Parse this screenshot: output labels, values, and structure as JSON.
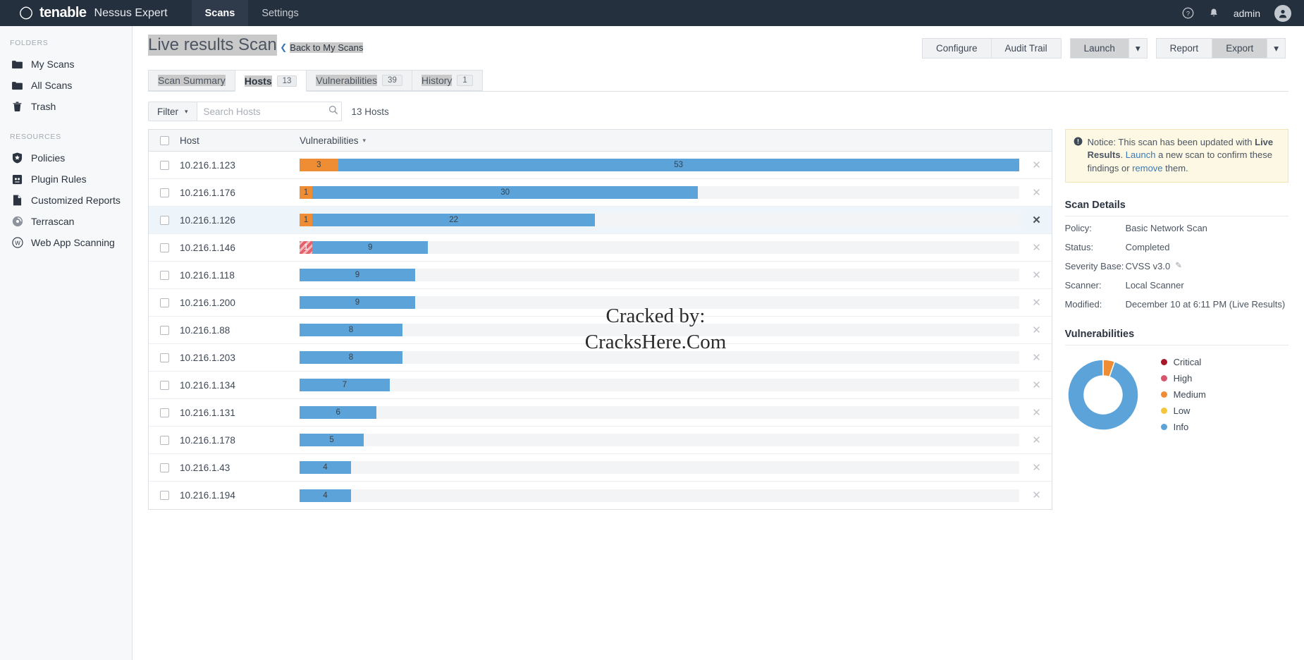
{
  "topnav": {
    "brand": "tenable",
    "product": "Nessus Expert",
    "items": [
      {
        "label": "Scans",
        "active": true
      },
      {
        "label": "Settings",
        "active": false
      }
    ],
    "help_icon": "help-circle-icon",
    "bell_icon": "notification-bell-icon",
    "user_label": "admin",
    "avatar_icon": "user-avatar-icon"
  },
  "sidebar": {
    "folders_label": "FOLDERS",
    "folders": [
      {
        "label": "My Scans",
        "icon": "folder-icon"
      },
      {
        "label": "All Scans",
        "icon": "folder-icon"
      },
      {
        "label": "Trash",
        "icon": "trash-icon"
      }
    ],
    "resources_label": "RESOURCES",
    "resources": [
      {
        "label": "Policies",
        "icon": "shield-star-icon"
      },
      {
        "label": "Plugin Rules",
        "icon": "plugin-rules-icon"
      },
      {
        "label": "Customized Reports",
        "icon": "document-icon"
      },
      {
        "label": "Terrascan",
        "icon": "terrascan-icon"
      },
      {
        "label": "Web App Scanning",
        "icon": "web-app-scanning-icon"
      }
    ]
  },
  "page": {
    "title": "Live results Scan",
    "back_link": "Back to My Scans",
    "back_chevron": "chevron-left-icon",
    "actions": {
      "configure": "Configure",
      "audit_trail": "Audit Trail",
      "launch": "Launch",
      "launch_caret": "chevron-down-icon",
      "report": "Report",
      "export": "Export",
      "export_caret": "chevron-down-icon"
    }
  },
  "tabs": [
    {
      "label": "Scan Summary",
      "badge": null,
      "active": false
    },
    {
      "label": "Hosts",
      "badge": "13",
      "active": true
    },
    {
      "label": "Vulnerabilities",
      "badge": "39",
      "active": false
    },
    {
      "label": "History",
      "badge": "1",
      "active": false
    }
  ],
  "filterbar": {
    "filter_label": "Filter",
    "filter_caret": "chevron-down-icon",
    "search_placeholder": "Search Hosts",
    "search_value": "",
    "search_icon": "search-icon",
    "host_count": "13 Hosts"
  },
  "table": {
    "columns": {
      "host": "Host",
      "vulnerabilities": "Vulnerabilities"
    },
    "sort_caret": "sort-descending-caret-icon",
    "delete_icon": "close-x-icon",
    "max_total": 56,
    "rows": [
      {
        "host": "10.216.1.123",
        "segments": [
          {
            "severity": "medium",
            "count": 3
          },
          {
            "severity": "info",
            "count": 53
          }
        ],
        "hovered": false
      },
      {
        "host": "10.216.1.176",
        "segments": [
          {
            "severity": "medium",
            "count": 1
          },
          {
            "severity": "info",
            "count": 30
          }
        ],
        "hovered": false
      },
      {
        "host": "10.216.1.126",
        "segments": [
          {
            "severity": "medium",
            "count": 1
          },
          {
            "severity": "info",
            "count": 22
          }
        ],
        "hovered": true
      },
      {
        "host": "10.216.1.146",
        "segments": [
          {
            "severity": "striped",
            "count": 1
          },
          {
            "severity": "info",
            "count": 9
          }
        ],
        "hovered": false
      },
      {
        "host": "10.216.1.118",
        "segments": [
          {
            "severity": "info",
            "count": 9
          }
        ],
        "hovered": false
      },
      {
        "host": "10.216.1.200",
        "segments": [
          {
            "severity": "info",
            "count": 9
          }
        ],
        "hovered": false
      },
      {
        "host": "10.216.1.88",
        "segments": [
          {
            "severity": "info",
            "count": 8
          }
        ],
        "hovered": false
      },
      {
        "host": "10.216.1.203",
        "segments": [
          {
            "severity": "info",
            "count": 8
          }
        ],
        "hovered": false
      },
      {
        "host": "10.216.1.134",
        "segments": [
          {
            "severity": "info",
            "count": 7
          }
        ],
        "hovered": false
      },
      {
        "host": "10.216.1.131",
        "segments": [
          {
            "severity": "info",
            "count": 6
          }
        ],
        "hovered": false
      },
      {
        "host": "10.216.1.178",
        "segments": [
          {
            "severity": "info",
            "count": 5
          }
        ],
        "hovered": false
      },
      {
        "host": "10.216.1.43",
        "segments": [
          {
            "severity": "info",
            "count": 4
          }
        ],
        "hovered": false
      },
      {
        "host": "10.216.1.194",
        "segments": [
          {
            "severity": "info",
            "count": 4
          }
        ],
        "hovered": false
      }
    ]
  },
  "notice": {
    "icon": "info-exclamation-icon",
    "text_1": "Notice: This scan has been updated with ",
    "bold_1": "Live Results",
    "text_2": ". ",
    "link_1": "Launch",
    "text_3": " a new scan to confirm these findings or ",
    "link_2": "remove",
    "text_4": " them."
  },
  "scan_details": {
    "heading": "Scan Details",
    "rows": [
      {
        "key": "Policy:",
        "value": "Basic Network Scan",
        "edit": false
      },
      {
        "key": "Status:",
        "value": "Completed",
        "edit": false
      },
      {
        "key": "Severity Base:",
        "value": "CVSS v3.0",
        "edit": true
      },
      {
        "key": "Scanner:",
        "value": "Local Scanner",
        "edit": false
      },
      {
        "key": "Modified:",
        "value": "December 10 at 6:11 PM (Live Results)",
        "edit": false
      }
    ],
    "edit_icon": "pencil-edit-icon"
  },
  "chart_data": {
    "type": "pie",
    "title": "Vulnerabilities",
    "donut": true,
    "legend_position": "right",
    "labels": [
      "Critical",
      "High",
      "Medium",
      "Low",
      "Info"
    ],
    "colors": [
      "#a8172a",
      "#d8556b",
      "#ee8d33",
      "#f5c63c",
      "#5ba3d8"
    ],
    "values": [
      0,
      0,
      3,
      0,
      53
    ],
    "legend": [
      {
        "label": "Critical",
        "color": "#a8172a",
        "value": 0
      },
      {
        "label": "High",
        "color": "#d8556b",
        "value": 0
      },
      {
        "label": "Medium",
        "color": "#ee8d33",
        "value": 3
      },
      {
        "label": "Low",
        "color": "#f5c63c",
        "value": 0
      },
      {
        "label": "Info",
        "color": "#5ba3d8",
        "value": 53
      }
    ]
  },
  "watermark": {
    "line1": "Cracked by:",
    "line2": "CracksHere.Com"
  }
}
